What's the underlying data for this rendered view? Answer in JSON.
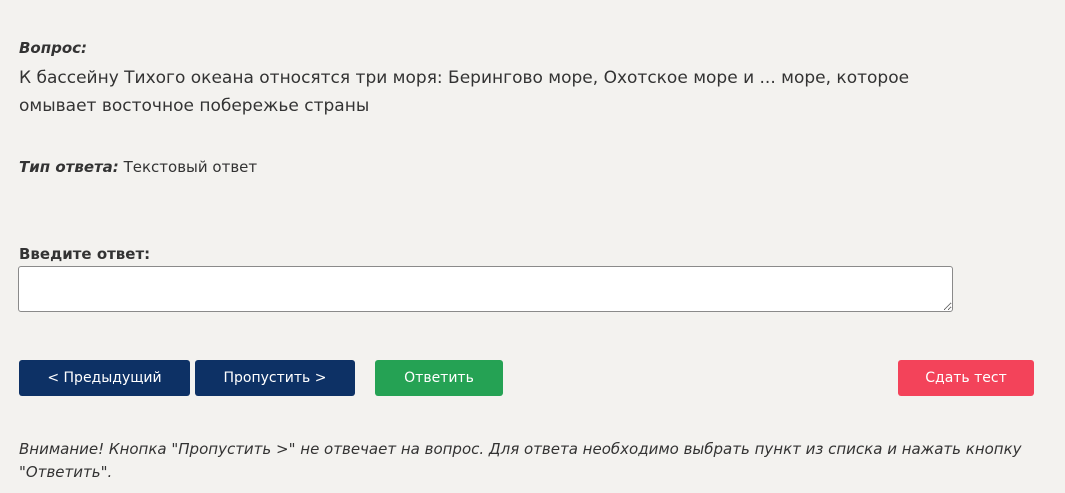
{
  "question": {
    "label": "Вопрос:",
    "text": "К бассейну Тихого океана относятся три моря: Берингово море, Охотское море и ... море, которое омывает восточное побережье страны"
  },
  "answer_type": {
    "label": "Тип ответа:",
    "value": "Текстовый ответ"
  },
  "answer_input": {
    "label": "Введите ответ:",
    "value": ""
  },
  "buttons": {
    "prev": "< Предыдущий",
    "skip": "Пропустить >",
    "answer": "Ответить",
    "finish": "Сдать тест"
  },
  "notice": "Внимание! Кнопка \"Пропустить >\" не отвечает на вопрос. Для ответа необходимо выбрать пункт из списка и нажать кнопку \"Ответить\".",
  "colors": {
    "background": "#f3f2ef",
    "nav_button": "#0d3165",
    "answer_button": "#25a254",
    "finish_button": "#f3435a"
  }
}
